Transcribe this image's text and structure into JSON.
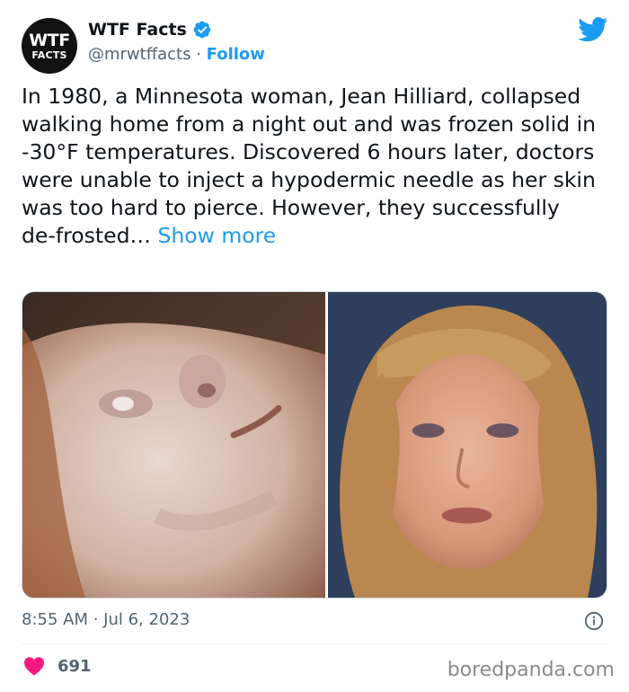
{
  "author": {
    "avatar_line1": "WTF",
    "avatar_line2": "FACTS",
    "name": "WTF Facts",
    "handle": "@mrwtffacts",
    "separator": " · ",
    "follow_label": "Follow"
  },
  "tweet": {
    "text": "In 1980, a Minnesota woman, Jean Hilliard, collapsed walking home from a night out and was frozen solid in -30°F temperatures. Discovered 6 hours later, doctors were unable to inject a hypodermic needle as her skin was too hard to pierce. However, they successfully de-frosted…",
    "show_more": "Show more",
    "timestamp": "8:55 AM · Jul 6, 2023",
    "like_count": "691"
  },
  "watermark": "boredpanda.com",
  "colors": {
    "accent": "#1d9bf0",
    "like": "#f91880",
    "muted": "#536471"
  },
  "icons": [
    "verified-badge-icon",
    "twitter-bird-icon",
    "info-icon",
    "heart-icon"
  ]
}
